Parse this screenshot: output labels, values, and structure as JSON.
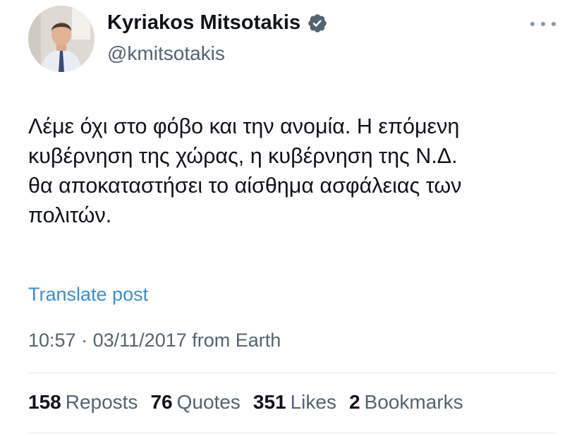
{
  "author": {
    "display_name": "Kyriakos Mitsotakis",
    "handle": "@kmitsotakis",
    "verified": true
  },
  "tweet": {
    "text_lines": [
      "Λέμε όχι στο φόβο και την ανομία. Η επόμενη",
      "κυβέρνηση της χώρας, η κυβέρνηση της Ν.Δ.",
      "θα αποκαταστήσει το αίσθημα ασφάλειας των",
      "πολιτών."
    ],
    "translate_label": "Translate post",
    "time": "10:57",
    "separator": "·",
    "date": "03/11/2017",
    "source": "from Earth"
  },
  "stats": {
    "reposts": {
      "count": "158",
      "label": "Reposts"
    },
    "quotes": {
      "count": "76",
      "label": "Quotes"
    },
    "likes": {
      "count": "351",
      "label": "Likes"
    },
    "bookmarks": {
      "count": "2",
      "label": "Bookmarks"
    }
  },
  "colors": {
    "link": "#3a8fd0",
    "secondary_text": "#536471",
    "verified_badge": "#536471"
  },
  "icons": {
    "verified": "verified-badge-icon",
    "more": "more-options-icon"
  }
}
